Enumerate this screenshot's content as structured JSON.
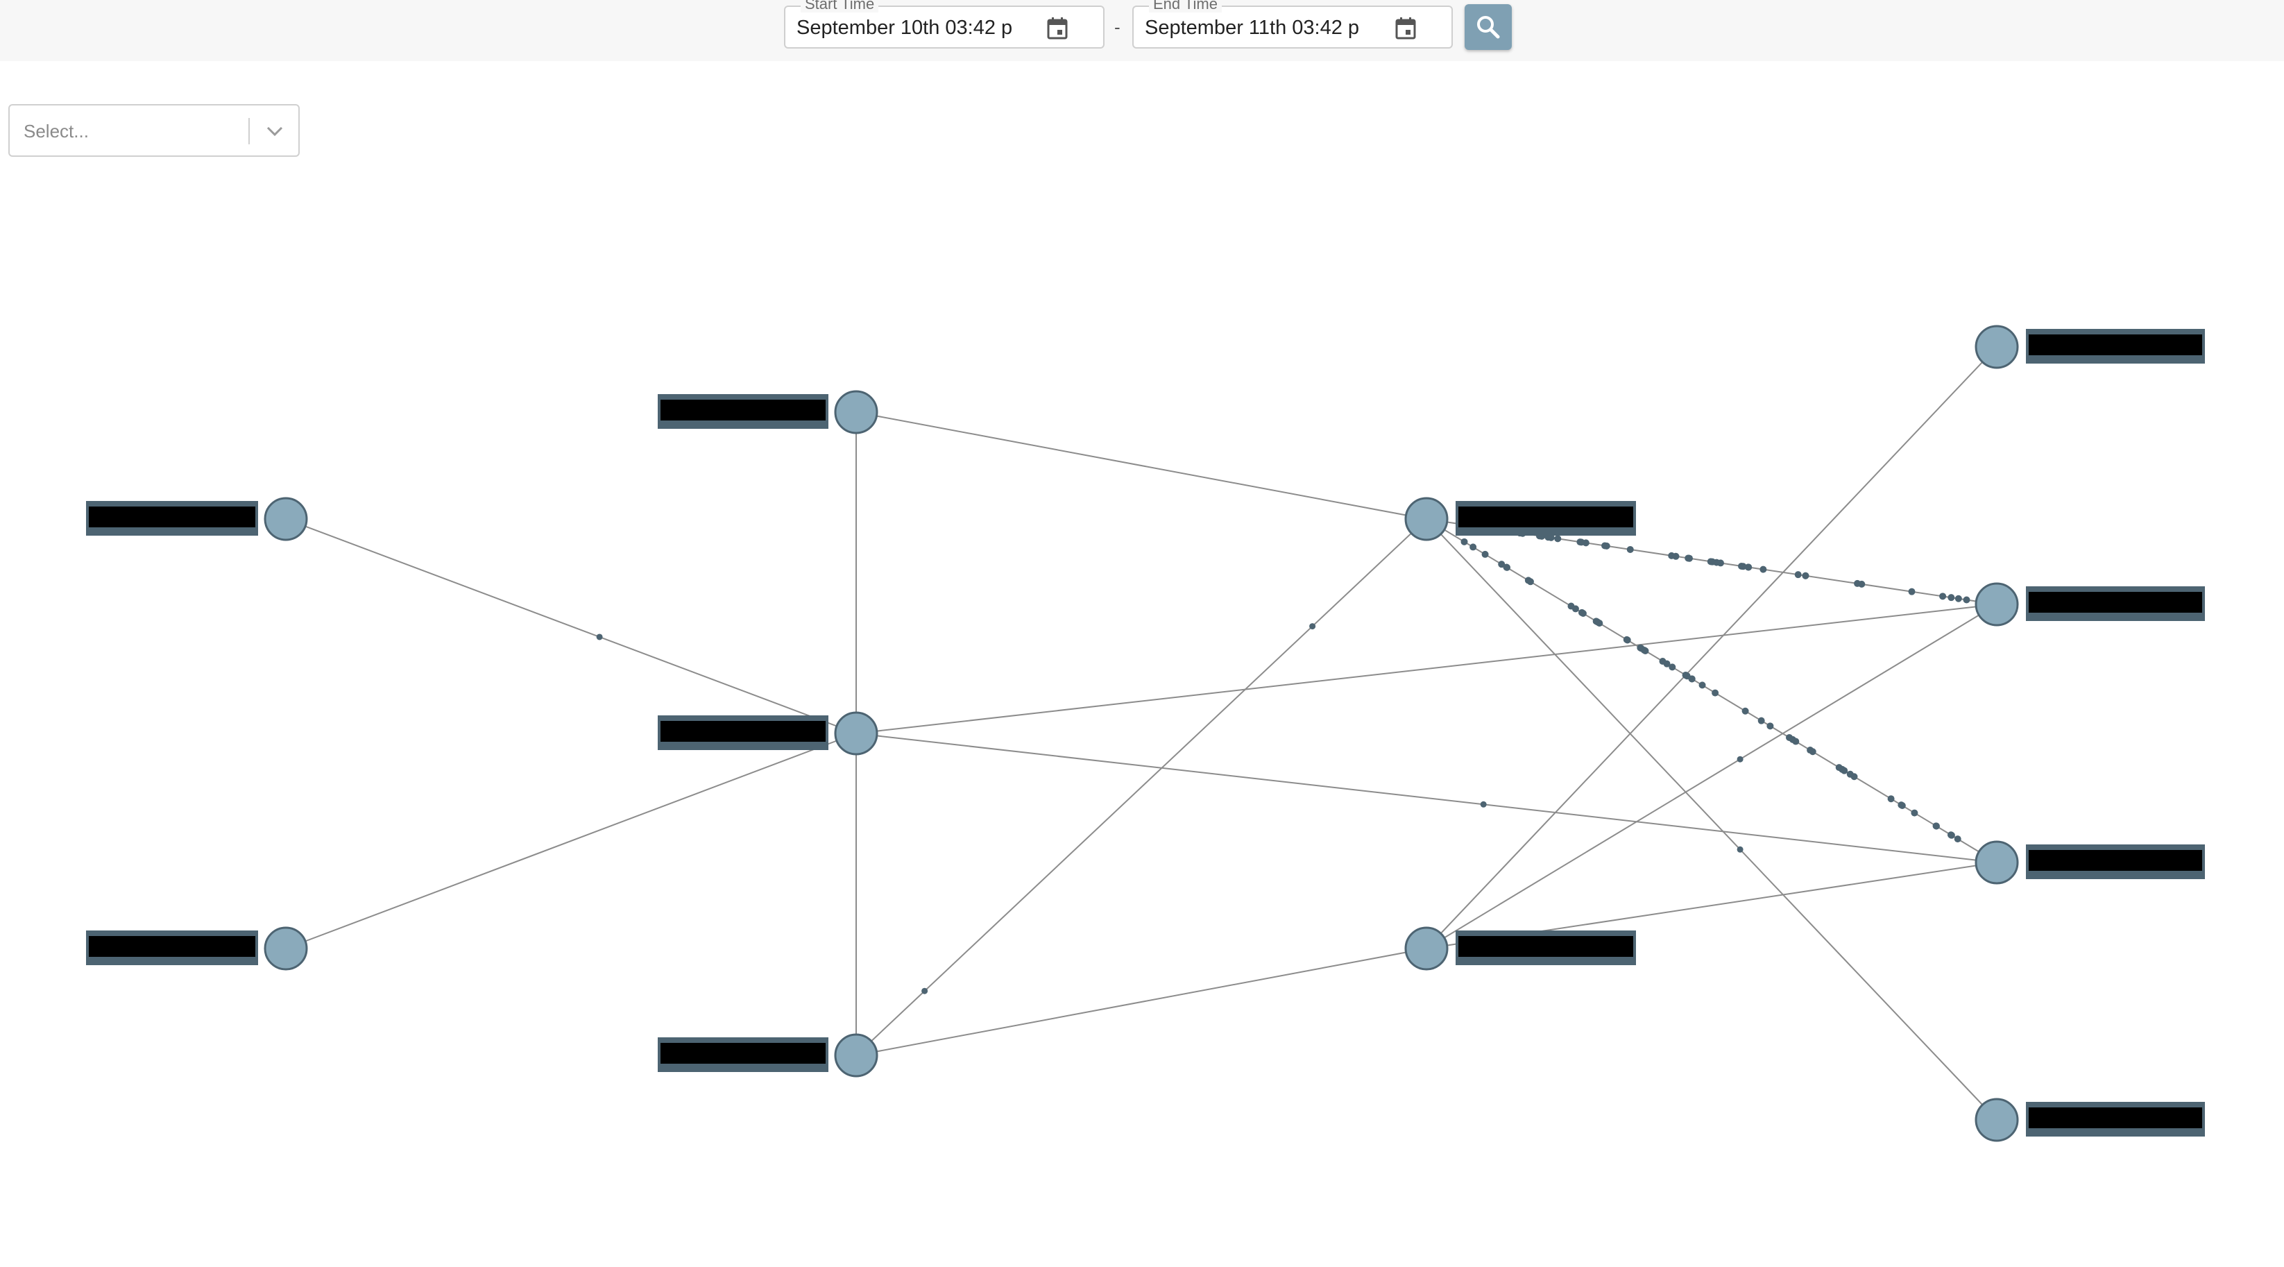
{
  "toolbar": {
    "start_label": "Start Time",
    "start_value": "September 10th 03:42 p",
    "end_label": "End Time",
    "end_value": "September 11th 03:42 p",
    "separator": "-",
    "search_icon": "search-icon",
    "calendar_icon": "calendar-icon"
  },
  "filter": {
    "placeholder": "Select...",
    "chevron_icon": "chevron-down-icon"
  },
  "colors": {
    "node_fill": "#8aaabb",
    "node_stroke": "#4d6472",
    "edge": "#8c8c8c",
    "label_bg": "#4d6472",
    "label_redaction": "#000000",
    "traffic_dot": "#4d6472"
  },
  "graph": {
    "nodes": [
      {
        "id": "n1",
        "col": 0
      },
      {
        "id": "n2",
        "col": 0
      },
      {
        "id": "n3",
        "col": 1
      },
      {
        "id": "n4",
        "col": 1
      },
      {
        "id": "n5",
        "col": 1
      },
      {
        "id": "n6",
        "col": 2
      },
      {
        "id": "n7",
        "col": 2
      },
      {
        "id": "n8",
        "col": 3
      },
      {
        "id": "n9",
        "col": 3
      },
      {
        "id": "n10",
        "col": 3
      },
      {
        "id": "n11",
        "col": 3
      }
    ],
    "edges": [
      {
        "from": "n1",
        "to": "n4",
        "dots": 1
      },
      {
        "from": "n2",
        "to": "n4",
        "dots": 0
      },
      {
        "from": "n3",
        "to": "n4",
        "dots": 0
      },
      {
        "from": "n4",
        "to": "n5",
        "dots": 0
      },
      {
        "from": "n3",
        "to": "n6",
        "dots": 0
      },
      {
        "from": "n4",
        "to": "n9",
        "dots": 0
      },
      {
        "from": "n4",
        "to": "n10",
        "dots": 1
      },
      {
        "from": "n5",
        "to": "n6",
        "dots": 2
      },
      {
        "from": "n5",
        "to": "n7",
        "dots": 0
      },
      {
        "from": "n6",
        "to": "n9",
        "dots": 40
      },
      {
        "from": "n6",
        "to": "n10",
        "dots": 55
      },
      {
        "from": "n6",
        "to": "n11",
        "dots": 1
      },
      {
        "from": "n7",
        "to": "n8",
        "dots": 0
      },
      {
        "from": "n7",
        "to": "n9",
        "dots": 1
      },
      {
        "from": "n7",
        "to": "n10",
        "dots": 0
      }
    ]
  }
}
